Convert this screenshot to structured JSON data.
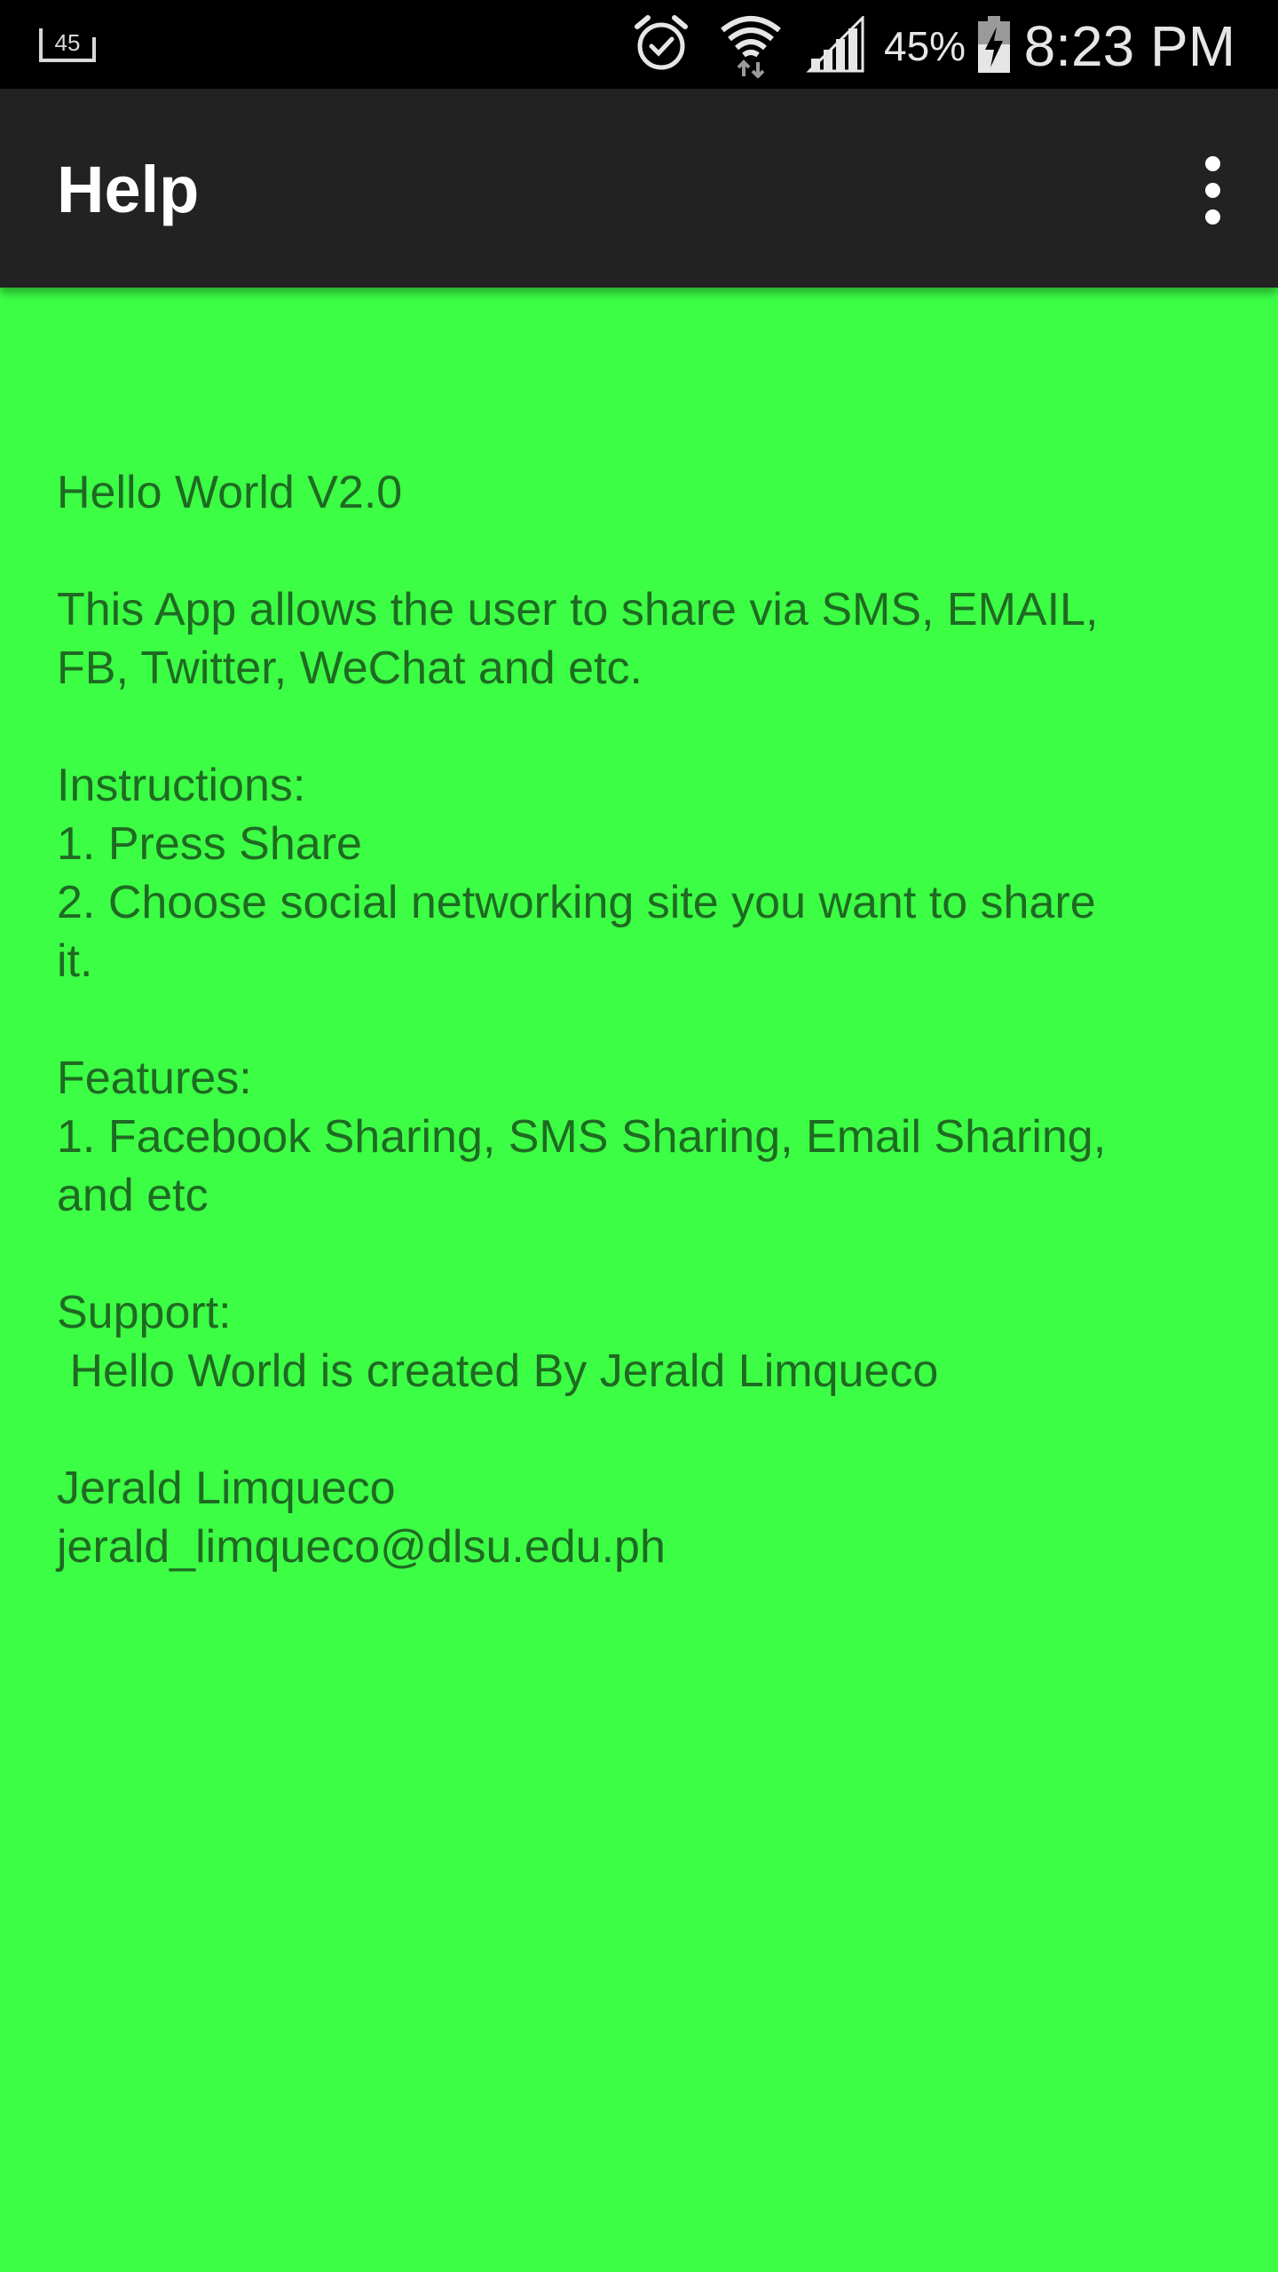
{
  "status_bar": {
    "notification_icon": "notification-count-icon",
    "notification_count": "45",
    "battery_percent": "45%",
    "time": "8:23 PM"
  },
  "app_bar": {
    "title": "Help",
    "overflow_icon": "more-vert-icon"
  },
  "help": {
    "app_name": "Hello World V2.0",
    "description_line1": "This App allows the user to share via SMS, EMAIL,",
    "description_line2": "FB, Twitter, WeChat and etc.",
    "instructions_heading": "Instructions:",
    "instruction1": "1. Press Share",
    "instruction2_line1": "2. Choose social networking site you want to share",
    "instruction2_line2": "it.",
    "features_heading": "Features:",
    "feature1_line1": "1. Facebook Sharing, SMS Sharing, Email Sharing,",
    "feature1_line2": "and etc",
    "support_heading": "Support:",
    "support_text": " Hello World is created By Jerald Limqueco",
    "contact_name": "Jerald Limqueco",
    "contact_email": "jerald_limqueco@dlsu.edu.ph"
  },
  "colors": {
    "background": "#3cff45",
    "text": "#1f6a22",
    "app_bar": "#222222",
    "status_bar": "#000000"
  }
}
